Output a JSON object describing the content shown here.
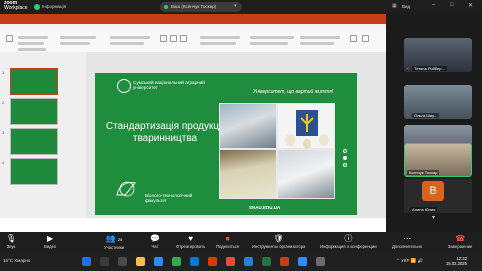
{
  "zoom": {
    "app_name": "zoom",
    "app_sub": "Workplace",
    "info_label": "Інформація",
    "share_label": "Ваш (Ксенчук Тоскар)",
    "view_label": "Вид"
  },
  "slide": {
    "university": "Сумський національний аграрний університет",
    "slogan": "Університет, що вартий життя!",
    "title": "Стандартизація продукції тваринництва",
    "faculty": "Біолого-технологічний факультет",
    "site": "SNAU.EDU.UA"
  },
  "thumbnails": [
    "1",
    "2",
    "3",
    "4"
  ],
  "participants": [
    {
      "name": "Тетяна Ройбер..."
    },
    {
      "name": "Ольга Шиу..."
    },
    {
      "name": "Оксана Мухан..."
    },
    {
      "name": "Ксенчук Тоскар"
    },
    {
      "name": "Алина Юлия",
      "initial": "B"
    }
  ],
  "toolbar": [
    {
      "icon": "mic-icon",
      "label": "Звук"
    },
    {
      "icon": "video-icon",
      "label": "Видео"
    },
    {
      "icon": "participants-icon",
      "label": "Участники",
      "count": "25"
    },
    {
      "icon": "chat-icon",
      "label": "Чат"
    },
    {
      "icon": "share-icon",
      "label": "Отреагировать"
    },
    {
      "icon": "share-screen-icon",
      "label": "Поделиться"
    },
    {
      "icon": "host-tools-icon",
      "label": "Инструменты организатора"
    },
    {
      "icon": "info-icon",
      "label": "Информация о конференции"
    },
    {
      "icon": "more-icon",
      "label": "Дополнительно"
    },
    {
      "icon": "end-icon",
      "label": "Завершение"
    }
  ],
  "taskbar": {
    "weather": "15°C Хмарно",
    "lang": "УКР",
    "time": "12:32",
    "date": "15.02.2025"
  },
  "colors": {
    "slide_green": "#1e8e3e",
    "ppt_accent": "#c43e1c",
    "zoom_dark": "#1e1e1e"
  }
}
